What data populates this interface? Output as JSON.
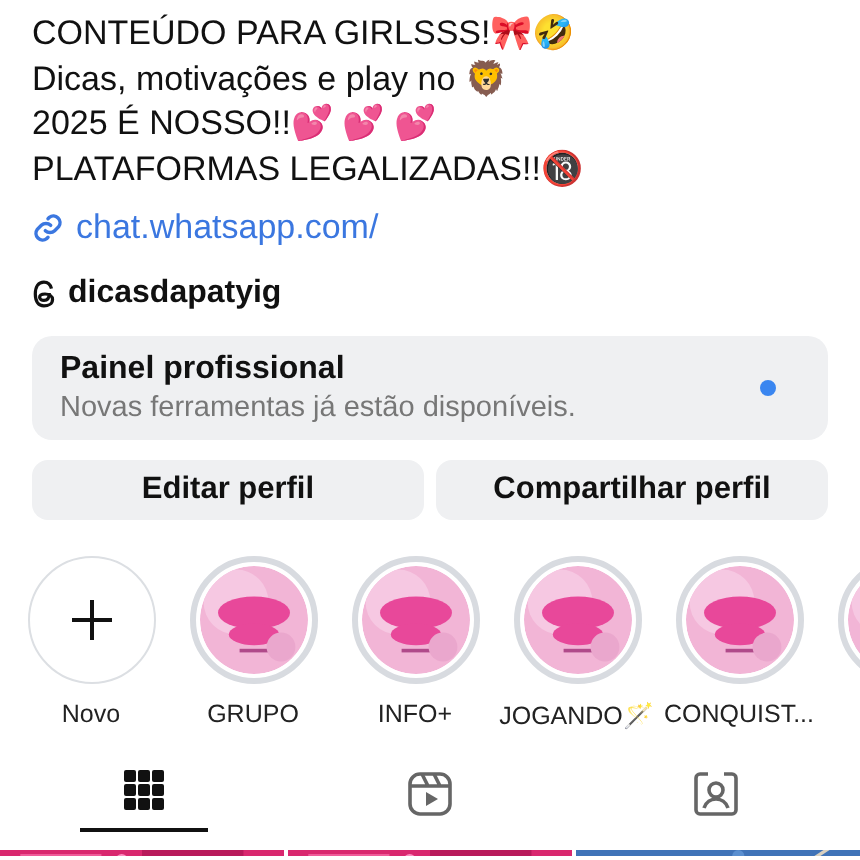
{
  "bio": {
    "lines": [
      "CONTEÚDO PARA GIRLSSS!🎀🤣",
      "Dicas, motivações e play no 🦁",
      "2025 É NOSSO!!💕 💕 💕",
      "PLATAFORMAS LEGALIZADAS!!🔞"
    ],
    "link": "chat.whatsapp.com/",
    "threads_handle": "dicasdapatyig"
  },
  "dashboard": {
    "title": "Painel profissional",
    "subtitle": "Novas ferramentas já estão disponíveis.",
    "unread": true
  },
  "buttons": [
    "Editar perfil",
    "Compartilhar perfil"
  ],
  "highlights": [
    {
      "kind": "new",
      "label": "Novo"
    },
    {
      "kind": "story",
      "label": "GRUPO"
    },
    {
      "kind": "story",
      "label": "INFO+"
    },
    {
      "kind": "story",
      "label": "JOGANDO🪄"
    },
    {
      "kind": "story",
      "label": "CONQUIST..."
    },
    {
      "kind": "story"
    }
  ],
  "tabs": [
    {
      "kind": "grid",
      "selected": true
    },
    {
      "kind": "reels",
      "selected": false
    },
    {
      "kind": "tagged",
      "selected": false
    }
  ]
}
